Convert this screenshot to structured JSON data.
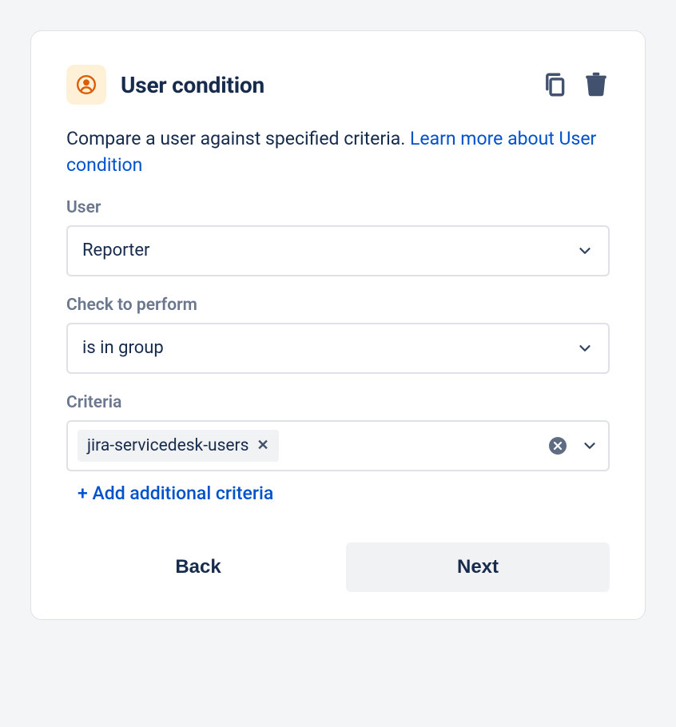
{
  "header": {
    "title": "User condition"
  },
  "description": {
    "text": "Compare a user against specified criteria. ",
    "link_text": "Learn more about User condition"
  },
  "fields": {
    "user": {
      "label": "User",
      "value": "Reporter"
    },
    "check": {
      "label": "Check to perform",
      "value": "is in group"
    },
    "criteria": {
      "label": "Criteria",
      "chip": "jira-servicedesk-users"
    }
  },
  "add_link": "+ Add additional criteria",
  "actions": {
    "back": "Back",
    "next": "Next"
  }
}
